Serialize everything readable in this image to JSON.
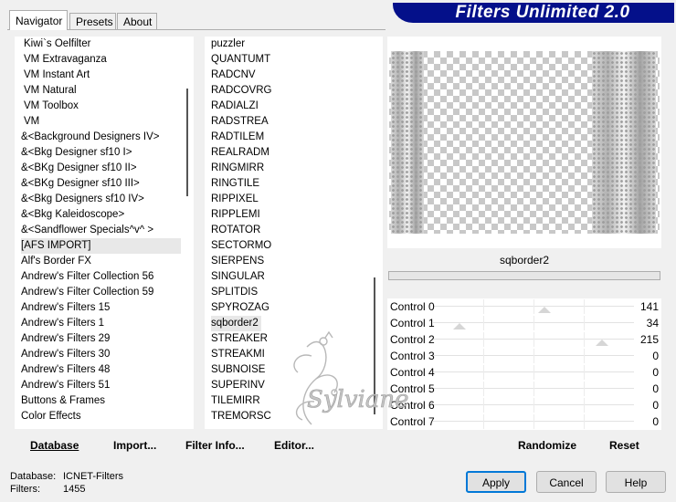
{
  "tabs": [
    {
      "label": "Navigator",
      "active": true
    },
    {
      "label": "Presets",
      "active": false
    },
    {
      "label": "About",
      "active": false
    }
  ],
  "title": "Filters Unlimited 2.0",
  "categories": {
    "items": [
      "Kiwi`s Oelfilter",
      "VM Extravaganza",
      "VM Instant Art",
      "VM Natural",
      "VM Toolbox",
      "VM",
      "&<Background Designers IV>",
      "&<Bkg Designer sf10 I>",
      "&<BKg Designer sf10 II>",
      "&<BKg Designer sf10 III>",
      "&<Bkg Designers sf10 IV>",
      "&<Bkg Kaleidoscope>",
      "&<Sandflower Specials^v^ >",
      "[AFS IMPORT]",
      "Alf's Border FX",
      "Andrew's Filter Collection 56",
      "Andrew's Filter Collection 59",
      "Andrew's Filters 15",
      "Andrew's Filters 1",
      "Andrew's Filters 29",
      "Andrew's Filters 30",
      "Andrew's Filters 48",
      "Andrew's Filters 51",
      "Buttons & Frames",
      "Color Effects"
    ],
    "selected_index": 13
  },
  "filters": {
    "items": [
      "puzzler",
      "QUANTUMT",
      "RADCNV",
      "RADCOVRG",
      "RADIALZI",
      "RADSTREA",
      "RADTILEM",
      "REALRADM",
      "RINGMIRR",
      "RINGTILE",
      "RIPPIXEL",
      "RIPPLEMI",
      "ROTATOR",
      "SECTORMO",
      "SIERPENS",
      "SINGULAR",
      "SPLITDIS",
      "SPYROZAG",
      "sqborder2",
      "STREAKER",
      "STREAKMI",
      "SUBNOISE",
      "SUPERINV",
      "TILEMIRR",
      "TREMORSC"
    ],
    "selected_index": 18
  },
  "preview": {
    "filter_name": "sqborder2"
  },
  "controls": [
    {
      "label": "Control 0",
      "value": "141",
      "level": 141
    },
    {
      "label": "Control 1",
      "value": "34",
      "level": 34
    },
    {
      "label": "Control 2",
      "value": "215",
      "level": 215
    },
    {
      "label": "Control 3",
      "value": "0",
      "level": 0
    },
    {
      "label": "Control 4",
      "value": "0",
      "level": 0
    },
    {
      "label": "Control 5",
      "value": "0",
      "level": 0
    },
    {
      "label": "Control 6",
      "value": "0",
      "level": 0
    },
    {
      "label": "Control 7",
      "value": "0",
      "level": 0
    }
  ],
  "toolbar": {
    "database": "Database",
    "import": "Import...",
    "filter_info": "Filter Info...",
    "editor": "Editor...",
    "randomize": "Randomize",
    "reset": "Reset"
  },
  "status": {
    "database_label": "Database:",
    "database_value": "ICNET-Filters",
    "filters_label": "Filters:",
    "filters_value": "1455"
  },
  "buttons": {
    "apply": "Apply",
    "cancel": "Cancel",
    "help": "Help"
  },
  "watermark_text": "Sylviane",
  "colors": {
    "title_bg": "#04108a",
    "apply_border": "#0078d7"
  }
}
